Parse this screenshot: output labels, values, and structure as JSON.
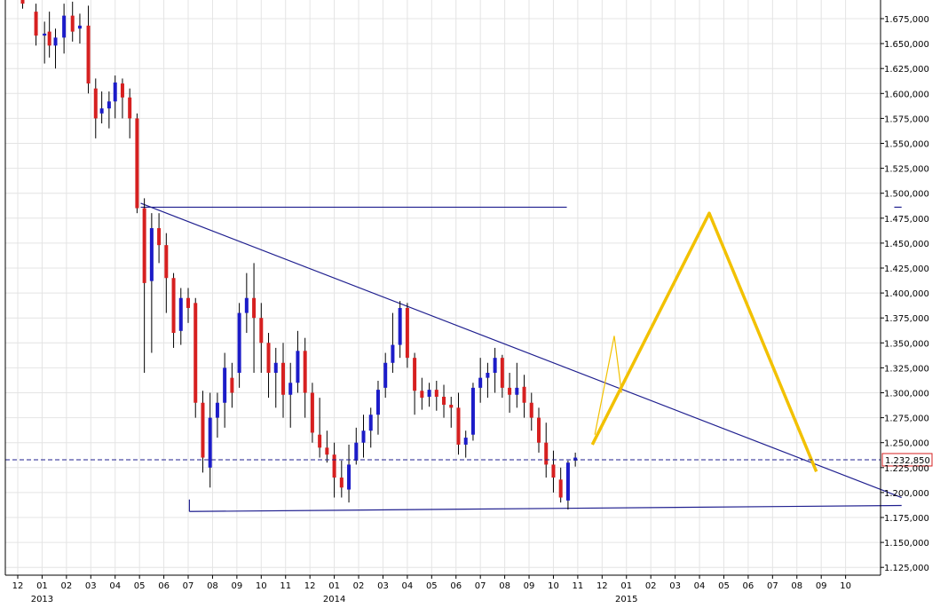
{
  "chart_data": {
    "type": "candlestick",
    "ylim": [
      1.125,
      1.685
    ],
    "y_ticks": [
      "1.125,000",
      "1.150,000",
      "1.175,000",
      "1.200,000",
      "1.225,000",
      "1.250,000",
      "1.275,000",
      "1.300,000",
      "1.325,000",
      "1.350,000",
      "1.375,000",
      "1.400,000",
      "1.425,000",
      "1.450,000",
      "1.475,000",
      "1.500,000",
      "1.525,000",
      "1.550,000",
      "1.575,000",
      "1.600,000",
      "1.625,000",
      "1.650,000",
      "1.675,000"
    ],
    "x_month_labels": [
      "12",
      "01",
      "02",
      "03",
      "04",
      "05",
      "06",
      "07",
      "08",
      "09",
      "10",
      "11",
      "12",
      "01",
      "02",
      "03",
      "04",
      "05",
      "06",
      "07",
      "08",
      "09",
      "10",
      "11",
      "12",
      "01",
      "02",
      "03",
      "04",
      "05",
      "06",
      "07",
      "08",
      "09",
      "10"
    ],
    "x_year_labels": [
      {
        "label": "2013",
        "month_index": 1
      },
      {
        "label": "2014",
        "month_index": 13
      },
      {
        "label": "2015",
        "month_index": 25
      }
    ],
    "current_price": {
      "value": 1.23285,
      "label": "1.232,850"
    },
    "colors": {
      "up": "#1c1cc8",
      "down": "#d62020",
      "wick": "#000000",
      "trendline": "#1f1f8f",
      "projection": "#f2c100",
      "current_price_box": "#d62020"
    },
    "candles": [
      [
        0.2,
        1.7,
        1.705,
        1.685,
        1.69
      ],
      [
        0.75,
        1.682,
        1.69,
        1.648,
        1.658
      ],
      [
        1.1,
        1.658,
        1.672,
        1.63,
        1.66
      ],
      [
        1.3,
        1.662,
        1.682,
        1.636,
        1.648
      ],
      [
        1.55,
        1.648,
        1.665,
        1.625,
        1.656
      ],
      [
        1.9,
        1.656,
        1.69,
        1.64,
        1.678
      ],
      [
        2.25,
        1.678,
        1.692,
        1.652,
        1.662
      ],
      [
        2.55,
        1.665,
        1.68,
        1.65,
        1.668
      ],
      [
        2.9,
        1.668,
        1.688,
        1.6,
        1.61
      ],
      [
        3.2,
        1.605,
        1.615,
        1.555,
        1.575
      ],
      [
        3.45,
        1.58,
        1.602,
        1.57,
        1.585
      ],
      [
        3.75,
        1.585,
        1.602,
        1.565,
        1.592
      ],
      [
        4.0,
        1.592,
        1.618,
        1.575,
        1.611
      ],
      [
        4.3,
        1.61,
        1.615,
        1.575,
        1.596
      ],
      [
        4.6,
        1.596,
        1.605,
        1.555,
        1.575
      ],
      [
        4.9,
        1.575,
        1.58,
        1.48,
        1.485
      ],
      [
        5.2,
        1.485,
        1.495,
        1.32,
        1.41
      ],
      [
        5.5,
        1.412,
        1.48,
        1.34,
        1.465
      ],
      [
        5.8,
        1.465,
        1.48,
        1.43,
        1.448
      ],
      [
        6.1,
        1.448,
        1.46,
        1.38,
        1.415
      ],
      [
        6.4,
        1.415,
        1.42,
        1.345,
        1.36
      ],
      [
        6.7,
        1.362,
        1.405,
        1.348,
        1.395
      ],
      [
        7.0,
        1.395,
        1.405,
        1.37,
        1.385
      ],
      [
        7.3,
        1.39,
        1.395,
        1.275,
        1.29
      ],
      [
        7.6,
        1.29,
        1.302,
        1.22,
        1.235
      ],
      [
        7.9,
        1.225,
        1.3,
        1.205,
        1.275
      ],
      [
        8.2,
        1.275,
        1.3,
        1.255,
        1.29
      ],
      [
        8.5,
        1.29,
        1.34,
        1.265,
        1.325
      ],
      [
        8.8,
        1.315,
        1.33,
        1.285,
        1.3
      ],
      [
        9.1,
        1.32,
        1.39,
        1.305,
        1.38
      ],
      [
        9.4,
        1.38,
        1.42,
        1.36,
        1.395
      ],
      [
        9.7,
        1.395,
        1.43,
        1.32,
        1.375
      ],
      [
        10.0,
        1.375,
        1.39,
        1.32,
        1.35
      ],
      [
        10.3,
        1.35,
        1.36,
        1.295,
        1.32
      ],
      [
        10.6,
        1.32,
        1.345,
        1.285,
        1.33
      ],
      [
        10.9,
        1.33,
        1.35,
        1.275,
        1.298
      ],
      [
        11.2,
        1.298,
        1.33,
        1.265,
        1.31
      ],
      [
        11.5,
        1.31,
        1.362,
        1.3,
        1.342
      ],
      [
        11.8,
        1.342,
        1.355,
        1.275,
        1.3
      ],
      [
        12.1,
        1.3,
        1.31,
        1.25,
        1.26
      ],
      [
        12.4,
        1.258,
        1.295,
        1.235,
        1.245
      ],
      [
        12.7,
        1.245,
        1.262,
        1.23,
        1.238
      ],
      [
        13.0,
        1.238,
        1.25,
        1.195,
        1.215
      ],
      [
        13.3,
        1.215,
        1.232,
        1.195,
        1.205
      ],
      [
        13.6,
        1.203,
        1.248,
        1.19,
        1.228
      ],
      [
        13.9,
        1.232,
        1.265,
        1.228,
        1.25
      ],
      [
        14.2,
        1.25,
        1.278,
        1.235,
        1.262
      ],
      [
        14.5,
        1.262,
        1.285,
        1.245,
        1.278
      ],
      [
        14.8,
        1.278,
        1.312,
        1.258,
        1.303
      ],
      [
        15.1,
        1.305,
        1.34,
        1.295,
        1.33
      ],
      [
        15.4,
        1.33,
        1.38,
        1.32,
        1.348
      ],
      [
        15.7,
        1.348,
        1.392,
        1.335,
        1.385
      ],
      [
        16.0,
        1.385,
        1.39,
        1.325,
        1.335
      ],
      [
        16.3,
        1.335,
        1.34,
        1.278,
        1.302
      ],
      [
        16.6,
        1.302,
        1.315,
        1.283,
        1.295
      ],
      [
        16.9,
        1.296,
        1.31,
        1.286,
        1.303
      ],
      [
        17.2,
        1.303,
        1.312,
        1.282,
        1.296
      ],
      [
        17.5,
        1.296,
        1.308,
        1.275,
        1.288
      ],
      [
        17.8,
        1.288,
        1.296,
        1.265,
        1.285
      ],
      [
        18.1,
        1.285,
        1.3,
        1.238,
        1.248
      ],
      [
        18.4,
        1.248,
        1.262,
        1.235,
        1.255
      ],
      [
        18.7,
        1.258,
        1.31,
        1.252,
        1.305
      ],
      [
        19.0,
        1.305,
        1.335,
        1.29,
        1.315
      ],
      [
        19.3,
        1.315,
        1.33,
        1.295,
        1.32
      ],
      [
        19.6,
        1.32,
        1.345,
        1.3,
        1.335
      ],
      [
        19.9,
        1.335,
        1.338,
        1.295,
        1.305
      ],
      [
        20.2,
        1.305,
        1.32,
        1.28,
        1.298
      ],
      [
        20.5,
        1.298,
        1.33,
        1.285,
        1.305
      ],
      [
        20.8,
        1.306,
        1.318,
        1.275,
        1.29
      ],
      [
        21.1,
        1.29,
        1.3,
        1.262,
        1.275
      ],
      [
        21.4,
        1.275,
        1.285,
        1.24,
        1.25
      ],
      [
        21.7,
        1.25,
        1.27,
        1.215,
        1.228
      ],
      [
        22.0,
        1.228,
        1.242,
        1.2,
        1.215
      ],
      [
        22.3,
        1.213,
        1.225,
        1.19,
        1.195
      ],
      [
        22.6,
        1.192,
        1.232,
        1.183,
        1.23
      ],
      [
        22.9,
        1.232,
        1.24,
        1.226,
        1.235
      ]
    ],
    "lines": [
      [
        5.05,
        1.486,
        22.55,
        1.486
      ],
      [
        36.0,
        1.486,
        36.3,
        1.486
      ],
      [
        7.05,
        1.181,
        36.3,
        1.187
      ],
      [
        5.05,
        1.49,
        36.3,
        1.195
      ],
      [
        7.05,
        1.181,
        7.05,
        1.193
      ]
    ],
    "projection_main": [
      [
        23.6,
        1.248
      ],
      [
        28.4,
        1.48
      ],
      [
        32.8,
        1.221
      ]
    ],
    "projection_small": [
      [
        23.7,
        1.258
      ],
      [
        24.5,
        1.357
      ],
      [
        24.8,
        1.3
      ]
    ]
  }
}
